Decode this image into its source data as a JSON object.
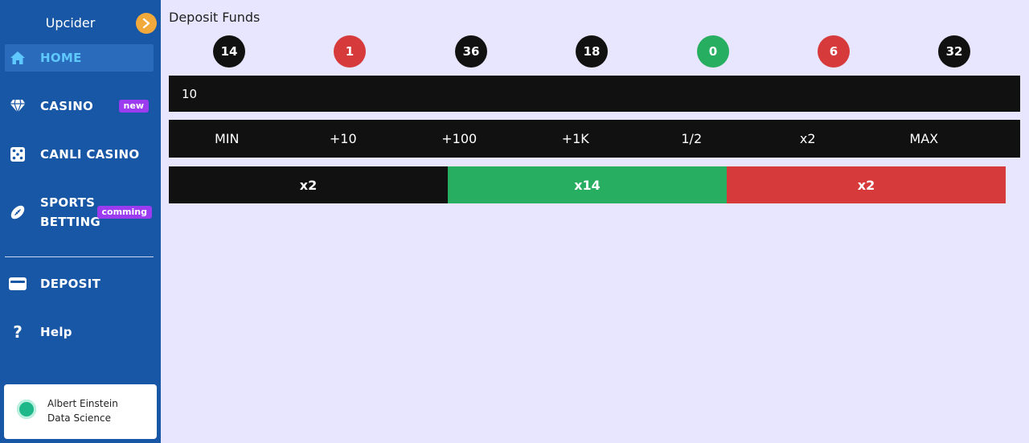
{
  "brand": {
    "name": "Upcider",
    "toggle_icon": "chevron-right-icon"
  },
  "colors": {
    "sidebar": "#1857a6",
    "background": "#e8e6fe",
    "accent_active": "#5ec8ff",
    "black": "#111111",
    "red": "#d63a3a",
    "green": "#27ae60",
    "badge": "#9b3cf0",
    "toggle": "#f2a93b"
  },
  "nav": {
    "home": {
      "label": "HOME",
      "icon": "home-icon"
    },
    "casino": {
      "label": "CASINO",
      "icon": "diamond-icon",
      "badge": "new"
    },
    "canli_casino": {
      "label": "CANLI CASINO",
      "icon": "dice-icon"
    },
    "sports": {
      "label_line1": "SPORTS",
      "label_line2": "BETTING",
      "icon": "football-icon",
      "badge": "comming"
    },
    "deposit": {
      "label": "DEPOSIT",
      "icon": "wallet-icon"
    },
    "help": {
      "label": "Help",
      "icon": "question-icon"
    }
  },
  "user": {
    "name": "Albert Einstein",
    "role": "Data Science",
    "status_icon": "online-status-icon"
  },
  "main": {
    "title": "Deposit Funds",
    "history": [
      {
        "value": "14",
        "color": "black"
      },
      {
        "value": "1",
        "color": "red"
      },
      {
        "value": "36",
        "color": "black"
      },
      {
        "value": "18",
        "color": "black"
      },
      {
        "value": "0",
        "color": "green"
      },
      {
        "value": "6",
        "color": "red"
      },
      {
        "value": "32",
        "color": "black"
      }
    ],
    "amount_value": "10",
    "quick_buttons": [
      "MIN",
      "+10",
      "+100",
      "+1K",
      "1/2",
      "x2",
      "MAX"
    ],
    "bets": [
      {
        "label": "x2",
        "color": "black"
      },
      {
        "label": "x14",
        "color": "green"
      },
      {
        "label": "x2",
        "color": "red"
      }
    ]
  }
}
